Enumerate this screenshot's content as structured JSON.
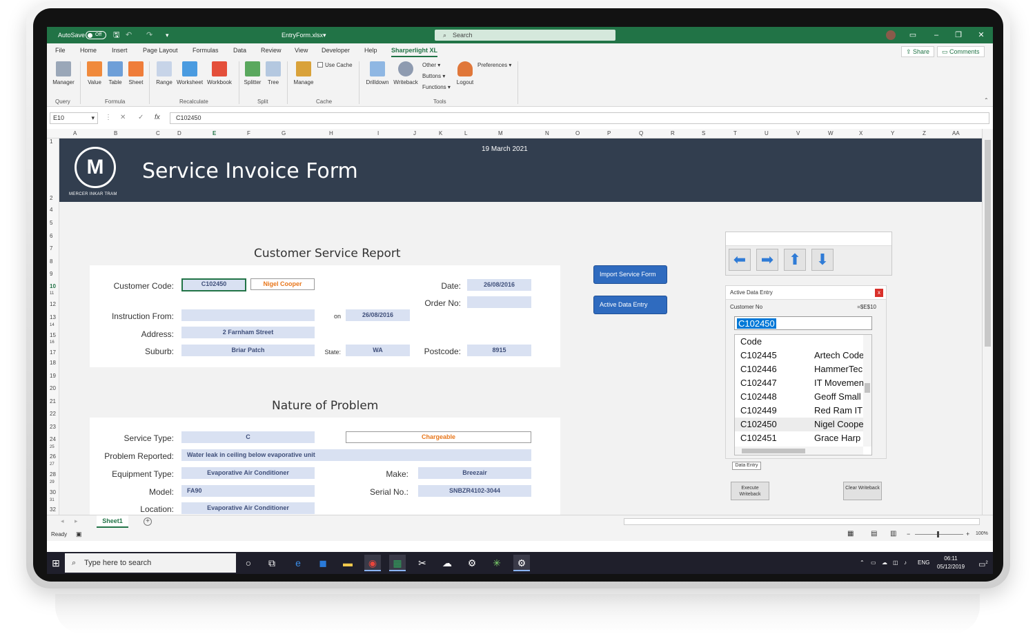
{
  "window": {
    "autosave_label": "AutoSave",
    "autosave_state": "Off",
    "filename": "EntryForm.xlsx",
    "search_placeholder": "Search",
    "accent": "#217346"
  },
  "menu": {
    "items": [
      "File",
      "Home",
      "Insert",
      "Page Layout",
      "Formulas",
      "Data",
      "Review",
      "View",
      "Developer",
      "Help",
      "Sharperlight XL"
    ],
    "active": "Sharperlight XL",
    "share": "Share",
    "comments": "Comments"
  },
  "ribbon": {
    "buttons": {
      "manager": "Manager",
      "value": "Value",
      "table": "Table",
      "sheet": "Sheet",
      "range": "Range",
      "worksheet": "Worksheet",
      "workbook": "Workbook",
      "splitter": "Splitter",
      "tree": "Tree",
      "manage": "Manage",
      "use_cache": "Use Cache",
      "drilldown": "Drilldown",
      "writeback": "Writeback",
      "other": "Other",
      "buttons": "Buttons",
      "functions": "Functions",
      "logout": "Logout",
      "preferences": "Preferences"
    },
    "groups": {
      "query": "Query",
      "formula": "Formula",
      "recalculate": "Recalculate",
      "split": "Split",
      "cache": "Cache",
      "tools": "Tools"
    }
  },
  "formula_bar": {
    "name_box": "E10",
    "fx": "fx",
    "content": "C102450"
  },
  "columns": [
    "A",
    "B",
    "C",
    "D",
    "E",
    "F",
    "G",
    "H",
    "I",
    "J",
    "K",
    "L",
    "M",
    "N",
    "O",
    "P",
    "Q",
    "R",
    "S",
    "T",
    "U",
    "V",
    "W",
    "X",
    "Y",
    "Z",
    "AA"
  ],
  "selected_column": "E",
  "rows": [
    "1",
    "2",
    "4",
    "5",
    "6",
    "7",
    "8",
    "9",
    "10",
    "11",
    "12",
    "13",
    "14",
    "15",
    "16",
    "17",
    "18",
    "19",
    "20",
    "21",
    "22",
    "23",
    "24",
    "25",
    "26",
    "27",
    "28",
    "29",
    "30",
    "31",
    "32"
  ],
  "selected_row": "10",
  "banner": {
    "company": "MERCER INKAR TRAM",
    "logo_letter": "M",
    "title": "Service Invoice Form",
    "date": "19 March 2021",
    "color": "#323e4f"
  },
  "report": {
    "section_title": "Customer Service Report",
    "customer_code_label": "Customer Code:",
    "customer_code": "C102450",
    "customer_name": "Nigel Cooper",
    "date_label": "Date:",
    "date": "26/08/2016",
    "order_no_label": "Order No:",
    "order_no": "",
    "instruction_label": "Instruction From:",
    "instruction": "",
    "on_label": "on",
    "on_date": "26/08/2016",
    "address_label": "Address:",
    "address": "2 Farnham Street",
    "suburb_label": "Suburb:",
    "suburb": "Briar Patch",
    "state_label": "State:",
    "state": "WA",
    "postcode_label": "Postcode:",
    "postcode": "8915"
  },
  "problem": {
    "section_title": "Nature of Problem",
    "service_type_label": "Service Type:",
    "service_type": "C",
    "chargeable": "Chargeable",
    "problem_label": "Problem Reported:",
    "problem": "Water leak in ceiling below evaporative unit",
    "equipment_label": "Equipment Type:",
    "equipment": "Evaporative Air Conditioner",
    "make_label": "Make:",
    "make": "Breezair",
    "model_label": "Model:",
    "model": "FA90",
    "serial_label": "Serial No.:",
    "serial": "SNBZR4102-3044",
    "location_label": "Location:",
    "location": "Evaporative Air Conditioner"
  },
  "sheet_buttons": {
    "import": "Import Service Form",
    "active": "Active Data Entry"
  },
  "nav_arrows": [
    "left-arrow-icon",
    "right-arrow-icon",
    "up-arrow-icon",
    "down-arrow-icon"
  ],
  "ade_pane": {
    "title": "Active Data Entry",
    "close": "x",
    "customer_no_label": "Customer No",
    "cell_ref": "=$E$10",
    "input_value": "C102450",
    "list": [
      {
        "code": "Code",
        "name": ""
      },
      {
        "code": "C102445",
        "name": "Artech Code"
      },
      {
        "code": "C102446",
        "name": "HammerTec"
      },
      {
        "code": "C102447",
        "name": "IT Movemen"
      },
      {
        "code": "C102448",
        "name": "Geoff Small"
      },
      {
        "code": "C102449",
        "name": "Red Ram IT"
      },
      {
        "code": "C102450",
        "name": "Nigel Coope"
      },
      {
        "code": "C102451",
        "name": "Grace Harp"
      }
    ],
    "data_entry_tab": "Data Entry",
    "execute": "Execute Writeback",
    "clear": "Clear Writeback"
  },
  "sheet_tab": "Sheet1",
  "status": {
    "ready": "Ready",
    "zoom": "100%"
  },
  "taskbar": {
    "search_placeholder": "Type here to search",
    "lang": "ENG",
    "time": "06:11",
    "date": "05/12/2019",
    "notifications": "2"
  }
}
